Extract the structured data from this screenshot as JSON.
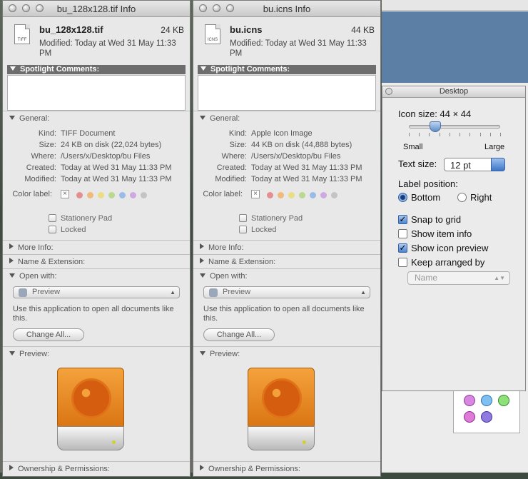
{
  "windows": [
    {
      "title": "bu_128x128.tif Info",
      "file_name": "bu_128x128.tif",
      "file_size": "24 KB",
      "file_icon": "TIFF",
      "modified": "Modified: Today at Wed 31 May 11:33 PM",
      "spotlight_header": "Spotlight Comments:",
      "general_header": "General:",
      "kind_label": "Kind:",
      "kind": "TIFF Document",
      "size_label": "Size:",
      "size": "24 KB on disk (22,024 bytes)",
      "where_label": "Where:",
      "where": "/Users/x/Desktop/bu Files",
      "created_label": "Created:",
      "created": "Today at Wed 31 May 11:33 PM",
      "modified_label": "Modified:",
      "modified_value": "Today at Wed 31 May 11:33 PM",
      "color_label": "Color label:",
      "stationery": "Stationery Pad",
      "locked": "Locked",
      "more_info": "More Info:",
      "name_ext": "Name & Extension:",
      "open_with": "Open with:",
      "app": "Preview",
      "use_text": "Use this application to open all documents like this.",
      "change_all": "Change All...",
      "preview": "Preview:",
      "ownership": "Ownership & Permissions:"
    },
    {
      "title": "bu.icns Info",
      "file_name": "bu.icns",
      "file_size": "44 KB",
      "file_icon": "ICNS",
      "modified": "Modified: Today at Wed 31 May 11:33 PM",
      "spotlight_header": "Spotlight Comments:",
      "general_header": "General:",
      "kind_label": "Kind:",
      "kind": "Apple Icon Image",
      "size_label": "Size:",
      "size": "44 KB on disk (44,888 bytes)",
      "where_label": "Where:",
      "where": "/Users/x/Desktop/bu Files",
      "created_label": "Created:",
      "created": "Today at Wed 31 May 11:33 PM",
      "modified_label": "Modified:",
      "modified_value": "Today at Wed 31 May 11:33 PM",
      "color_label": "Color label:",
      "stationery": "Stationery Pad",
      "locked": "Locked",
      "more_info": "More Info:",
      "name_ext": "Name & Extension:",
      "open_with": "Open with:",
      "app": "Preview",
      "use_text": "Use this application to open all documents like this.",
      "change_all": "Change All...",
      "preview": "Preview:",
      "ownership": "Ownership & Permissions:"
    }
  ],
  "color_dots": [
    "#e26a6a",
    "#f2a64c",
    "#ecd85a",
    "#a8d26a",
    "#79a8e6",
    "#c58de0",
    "#b5b5b5"
  ],
  "desktop": {
    "title": "Desktop",
    "icon_size_label": "Icon size: 44 × 44",
    "icon_size_level": 0.29,
    "small": "Small",
    "large": "Large",
    "text_size_label": "Text size:",
    "text_size": "12 pt",
    "label_position": "Label position:",
    "bottom": "Bottom",
    "right": "Right",
    "snap": "Snap to grid",
    "snap_checked": true,
    "show_info": "Show item info",
    "show_info_checked": false,
    "show_preview": "Show icon preview",
    "show_preview_checked": true,
    "keep_arranged": "Keep arranged by",
    "keep_arranged_checked": false,
    "arranged_by": "Name"
  }
}
